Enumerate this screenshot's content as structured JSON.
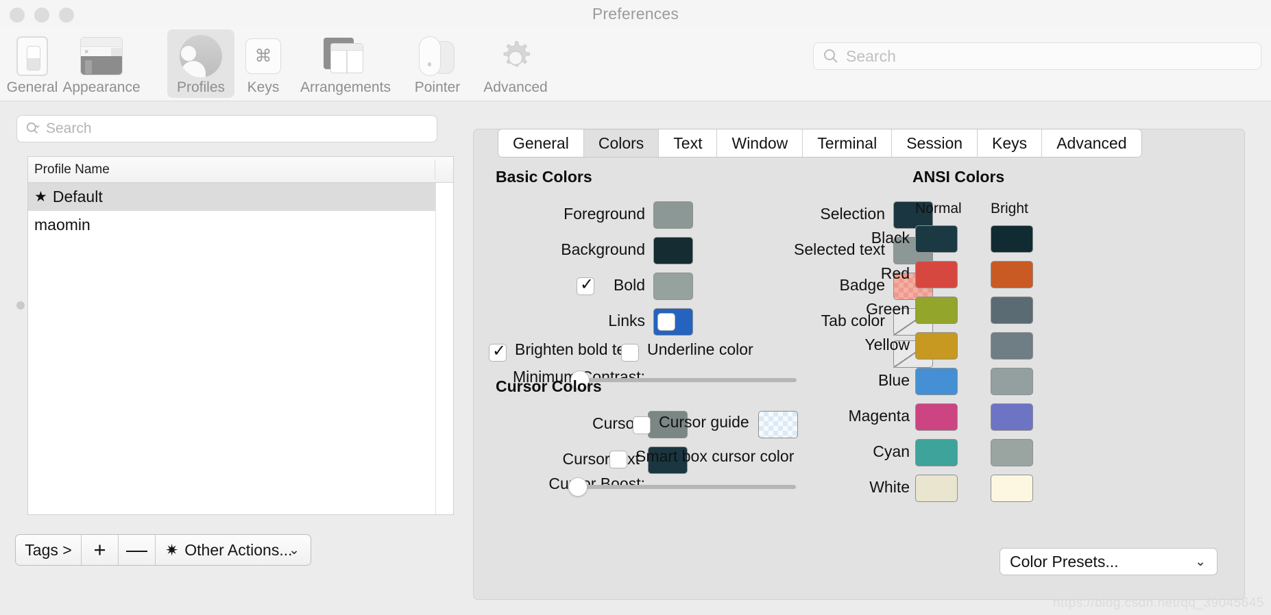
{
  "window": {
    "title": "Preferences",
    "traffic_lights": [
      "close",
      "minimize",
      "zoom"
    ]
  },
  "top_search": {
    "placeholder": "Search",
    "icon": "search-icon"
  },
  "toolbar": {
    "items": [
      {
        "label": "General",
        "icon": "general-icon",
        "selected": false
      },
      {
        "label": "Appearance",
        "icon": "appearance-icon",
        "selected": false
      },
      {
        "label": "Profiles",
        "icon": "profiles-icon",
        "selected": true
      },
      {
        "label": "Keys",
        "icon": "keys-icon",
        "selected": false
      },
      {
        "label": "Arrangements",
        "icon": "arrangements-icon",
        "selected": false
      },
      {
        "label": "Pointer",
        "icon": "pointer-icon",
        "selected": false
      },
      {
        "label": "Advanced",
        "icon": "gear-icon",
        "selected": false
      }
    ]
  },
  "left_panel": {
    "search": {
      "placeholder": "Search",
      "icon": "search-dropdown-icon"
    },
    "list": {
      "column_header": "Profile Name",
      "rows": [
        {
          "name": "Default",
          "starred": true,
          "selected": true
        },
        {
          "name": "maomin",
          "starred": false,
          "selected": false
        }
      ]
    },
    "bottom_toolbar": {
      "tags_label": "Tags >",
      "add_label": "+",
      "remove_label": "—",
      "other_actions_label": "Other Actions...",
      "other_actions_icon": "gear-icon",
      "chevron": "⌄"
    }
  },
  "tabs": [
    {
      "label": "General",
      "active": false
    },
    {
      "label": "Colors",
      "active": true
    },
    {
      "label": "Text",
      "active": false
    },
    {
      "label": "Window",
      "active": false
    },
    {
      "label": "Terminal",
      "active": false
    },
    {
      "label": "Session",
      "active": false
    },
    {
      "label": "Keys",
      "active": false
    },
    {
      "label": "Advanced",
      "active": false
    }
  ],
  "colors_tab": {
    "basic_colors": {
      "title": "Basic Colors",
      "left_fields": [
        {
          "label": "Foreground",
          "color": "#8c9896",
          "type": "solid",
          "checkbox": null
        },
        {
          "label": "Background",
          "color": "#142c32",
          "type": "solid",
          "checkbox": null
        },
        {
          "label": "Bold",
          "color": "#96a29e",
          "type": "solid",
          "checkbox": true
        },
        {
          "label": "Links",
          "color": "#2463c0",
          "type": "solid",
          "checkbox": null
        }
      ],
      "right_fields": [
        {
          "label": "Selection",
          "color": "#1a3640",
          "type": "solid",
          "checkbox": null
        },
        {
          "label": "Selected text",
          "color": "#8c9896",
          "type": "solid",
          "checkbox": null
        },
        {
          "label": "Badge",
          "color": "#f09a8c",
          "type": "checker-pink",
          "checkbox": null
        },
        {
          "label": "Tab color",
          "color": null,
          "type": "empty",
          "checkbox": false
        },
        {
          "label": "Underline color",
          "color": null,
          "type": "empty",
          "checkbox": false
        }
      ],
      "brighten_bold_text": {
        "label": "Brighten bold text",
        "checked": true
      },
      "minimum_contrast": {
        "label": "Minimum Contrast:",
        "value": 0
      }
    },
    "cursor_colors": {
      "title": "Cursor Colors",
      "left_fields": [
        {
          "label": "Cursor",
          "color": "#7a8784",
          "type": "solid"
        },
        {
          "label": "Cursor text",
          "color": "#1a3640",
          "type": "solid"
        }
      ],
      "right_fields": [
        {
          "label": "Cursor guide",
          "color": "#eef6fb",
          "type": "checker-blue",
          "checked": false
        },
        {
          "label": "Smart box cursor color",
          "color": null,
          "type": "none",
          "checked": false
        }
      ],
      "cursor_boost": {
        "label": "Cursor Boost:",
        "value": 0
      }
    },
    "ansi_colors": {
      "title": "ANSI Colors",
      "columns": [
        "Normal",
        "Bright"
      ],
      "rows": [
        {
          "name": "Black",
          "normal": "#1b3943",
          "bright": "#112b33"
        },
        {
          "name": "Red",
          "normal": "#d6483f",
          "bright": "#ca5a24"
        },
        {
          "name": "Green",
          "normal": "#93a52a",
          "bright": "#5b6b73"
        },
        {
          "name": "Yellow",
          "normal": "#c79921",
          "bright": "#6f7d85"
        },
        {
          "name": "Blue",
          "normal": "#4590d4",
          "bright": "#93a09f"
        },
        {
          "name": "Magenta",
          "normal": "#cd4482",
          "bright": "#6d74c4"
        },
        {
          "name": "Cyan",
          "normal": "#3ea39a",
          "bright": "#9aa5a2"
        },
        {
          "name": "White",
          "normal": "#e9e5cf",
          "bright": "#fdf6e0"
        }
      ],
      "presets_label": "Color Presets...",
      "presets_chevron": "⌄"
    }
  },
  "watermark": "https://blog.csdn.net/qq_39045645"
}
